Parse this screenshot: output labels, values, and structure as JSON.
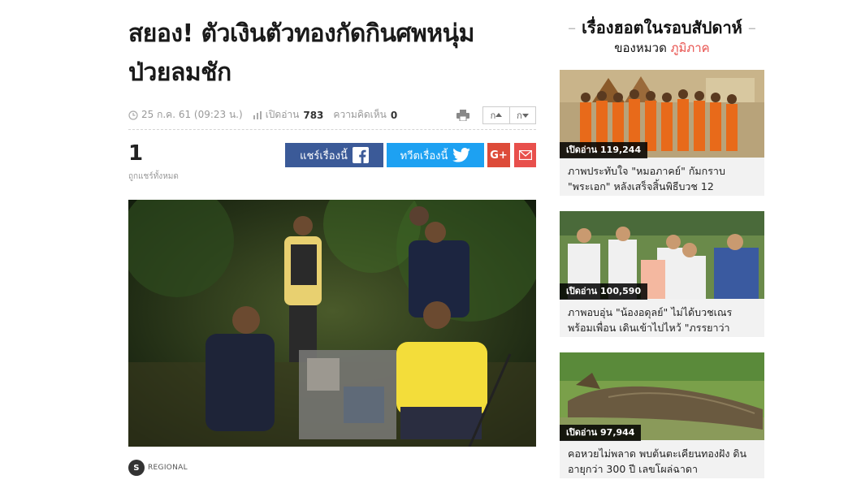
{
  "article": {
    "title_line1": "สยอง! ตัวเงินตัวทองกัดกินศพหนุ่ม",
    "title_line2": "ป่วยลมชัก",
    "date": "25 ก.ค. 61 (09:23 น.)",
    "views_label": "เปิดอ่าน",
    "views_value": "783",
    "comments_label": "ความคิดเห็น",
    "comments_value": "0",
    "font_increase_label": "ก",
    "font_decrease_label": "ก"
  },
  "share": {
    "count": "1",
    "count_label": "ถูกแชร์ทั้งหมด",
    "facebook_label": "แชร์เรื่องนี้",
    "twitter_label": "ทวีตเรื่องนี้",
    "googleplus_label": "G+"
  },
  "source": {
    "logo_mark": "S",
    "name": "REGIONAL"
  },
  "sidebar": {
    "title": "เรื่องฮอตในรอบสัปดาห์",
    "subtitle_prefix": "ของหมวด",
    "category": "ภูมิภาค",
    "cards": [
      {
        "views": "เปิดอ่าน 119,244",
        "title": "ภาพประทับใจ \"หมอภาคย์\" กัมกราบ \"พระเอก\" หลังเสร็จสิ้นพิธีบวช 12"
      },
      {
        "views": "เปิดอ่าน 100,590",
        "title": "ภาพอบอุ่น \"น้องอดุลย์\" ไม่ได้บวชเณร พร้อมเพื่อน เดินเข้าไปไหว้ \"ภรรยาว่า"
      },
      {
        "views": "เปิดอ่าน 97,944",
        "title": "คอหวยไม่พลาด พบต้นตะเคียนทองฝัง ดินอายุกว่า 300 ปี เลขโผล่ฉาดา"
      }
    ]
  },
  "colors": {
    "facebook": "#3b5a98",
    "twitter": "#1da1f2",
    "googleplus": "#dd4b39",
    "mail": "#e8504c",
    "accent": "#e8504c"
  }
}
